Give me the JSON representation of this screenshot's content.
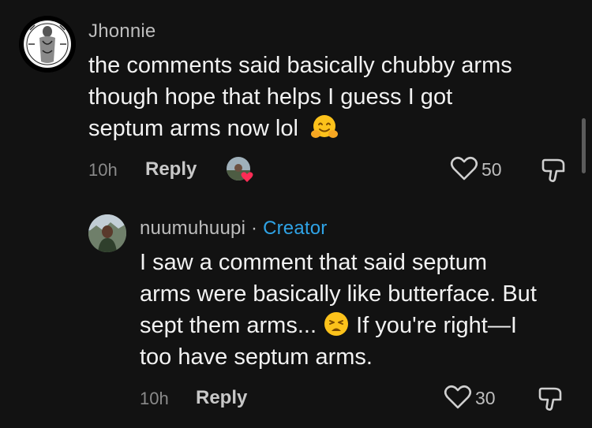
{
  "comment": {
    "username": "Jhonnie",
    "text_line1": "the comments said basically chubby arms",
    "text_line2": "though hope that helps I guess I got",
    "text_line3": "septum arms now lol",
    "time": "10h",
    "reply_label": "Reply",
    "likes": "50"
  },
  "reply": {
    "username": "nuumuhuupi",
    "separator": "·",
    "badge": "Creator",
    "text_line1": "I saw a comment that said septum",
    "text_line2": "arms were basically like butterface. But",
    "text_line3_a": "sept them arms...",
    "text_line3_b": "If you're right—I",
    "text_line4": "too have septum arms.",
    "time": "10h",
    "reply_label": "Reply",
    "likes": "30"
  },
  "colors": {
    "background": "#121212",
    "creator_badge": "#2fa3e6",
    "heart_liked": "#fe2c55"
  }
}
